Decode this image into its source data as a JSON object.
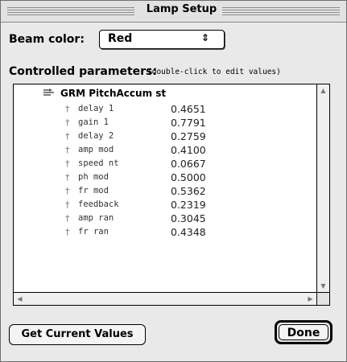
{
  "window": {
    "title": "Lamp Setup"
  },
  "beam": {
    "label": "Beam color:",
    "value": "Red",
    "arrows": "⇕"
  },
  "params": {
    "label": "Controlled parameters:",
    "hint": "(double-click to edit values)",
    "group": "GRM PitchAccum st",
    "bullet": "†",
    "rows": [
      {
        "name": "delay 1",
        "value": "0.4651"
      },
      {
        "name": "gain 1",
        "value": "0.7791"
      },
      {
        "name": "delay 2",
        "value": "0.2759"
      },
      {
        "name": "amp mod",
        "value": "0.4100"
      },
      {
        "name": "speed nt",
        "value": "0.0667"
      },
      {
        "name": "ph mod",
        "value": "0.5000"
      },
      {
        "name": "fr mod",
        "value": "0.5362"
      },
      {
        "name": "feedback",
        "value": "0.2319"
      },
      {
        "name": "amp ran",
        "value": "0.3045"
      },
      {
        "name": "fr ran",
        "value": "0.4348"
      }
    ]
  },
  "buttons": {
    "get_current": "Get Current Values",
    "done": "Done"
  }
}
